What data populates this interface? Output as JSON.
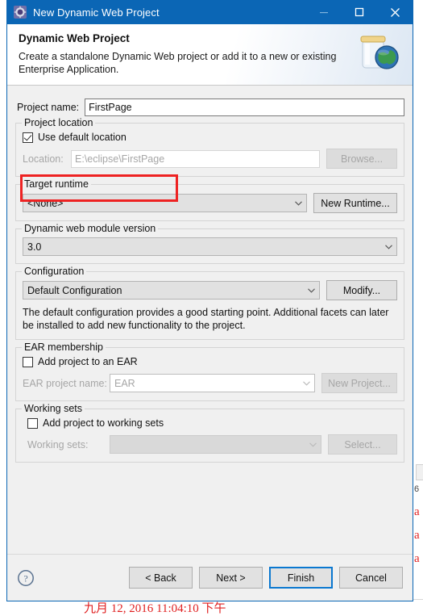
{
  "window": {
    "title": "New Dynamic Web Project",
    "icon": "eclipse-wizard-icon",
    "minimize_label": "—",
    "maximize_label": "□",
    "close_label": "✕"
  },
  "header": {
    "title": "Dynamic Web Project",
    "description": "Create a standalone Dynamic Web project or add it to a new or existing Enterprise Application.",
    "icon": "web-project-jar-globe-icon"
  },
  "project_name": {
    "label": "Project name:",
    "value": "FirstPage",
    "placeholder": ""
  },
  "annotation": {
    "color": "#ee2222",
    "target": "project-name-row"
  },
  "project_location": {
    "legend": "Project location",
    "use_default_label": "Use default location",
    "use_default_checked": true,
    "location_label": "Location:",
    "location_value": "E:\\eclipse\\FirstPage",
    "browse_label": "Browse...",
    "browse_enabled": false
  },
  "target_runtime": {
    "legend": "Target runtime",
    "value": "<None>",
    "new_runtime_label": "New Runtime...",
    "new_runtime_enabled": true
  },
  "module_version": {
    "legend": "Dynamic web module version",
    "value": "3.0"
  },
  "configuration": {
    "legend": "Configuration",
    "value": "Default Configuration",
    "modify_label": "Modify...",
    "modify_enabled": true,
    "description": "The default configuration provides a good starting point. Additional facets can later be installed to add new functionality to the project."
  },
  "ear_membership": {
    "legend": "EAR membership",
    "add_label": "Add project to an EAR",
    "add_checked": false,
    "project_name_label": "EAR project name:",
    "project_name_value": "EAR",
    "new_project_label": "New Project...",
    "new_project_enabled": false
  },
  "working_sets": {
    "legend": "Working sets",
    "add_label": "Add project to working sets",
    "add_checked": false,
    "sets_label": "Working sets:",
    "sets_value": "",
    "select_label": "Select...",
    "select_enabled": false
  },
  "buttons": {
    "help_icon": "help-question-icon",
    "back": "< Back",
    "next": "Next >",
    "finish": "Finish",
    "cancel": "Cancel",
    "default_button": "Finish"
  },
  "background": {
    "red_line": "九月 12, 2016 11:04:10 下午",
    "side_marks": [
      "6",
      "a",
      "a",
      "a"
    ]
  },
  "colors": {
    "titlebar": "#0b66b5",
    "dialog_bg": "#f0f0f0",
    "accent": "#0b78d0",
    "annotation_red": "#ee2222"
  }
}
